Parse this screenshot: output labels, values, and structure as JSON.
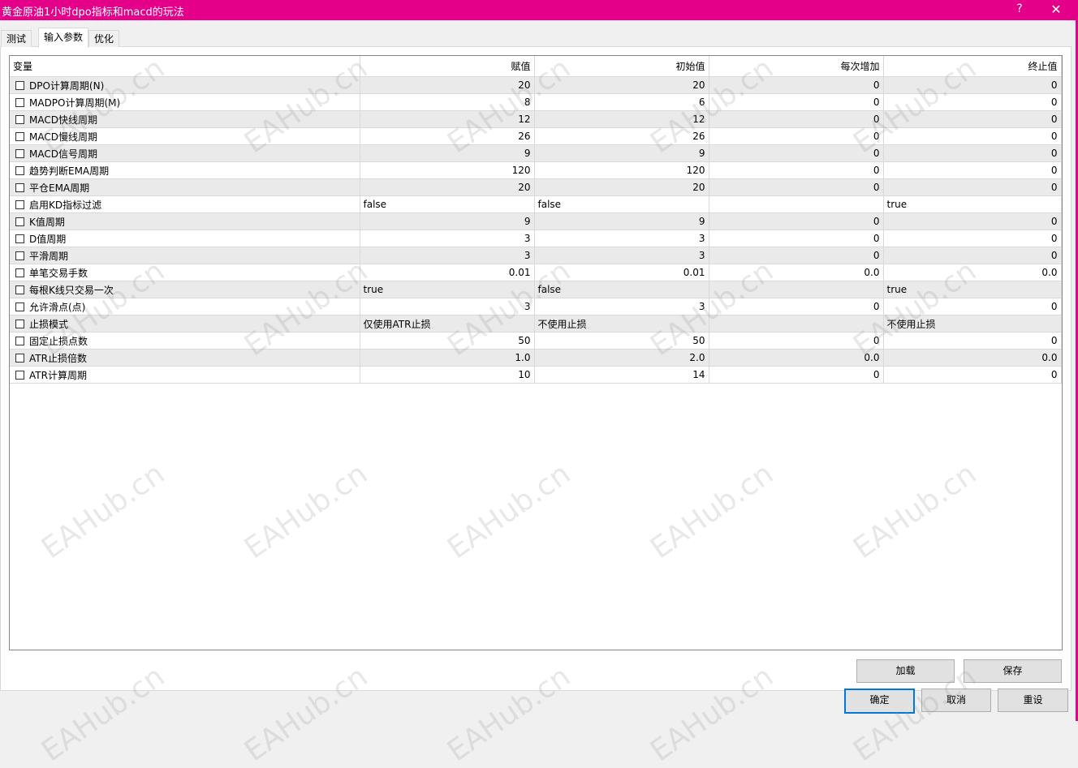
{
  "window": {
    "title": "黄金原油1小时dpo指标和macd的玩法",
    "help_label": "?",
    "close_label": "✕"
  },
  "tabs": [
    {
      "label": "测试",
      "active": false
    },
    {
      "label": "输入参数",
      "active": true
    },
    {
      "label": "优化",
      "active": false
    }
  ],
  "grid": {
    "headers": {
      "variable": "变量",
      "value": "赋值",
      "start": "初始值",
      "step": "每次增加",
      "stop": "终止值"
    },
    "rows": [
      {
        "name": "DPO计算周期(N)",
        "value": "20",
        "start": "20",
        "step": "0",
        "stop": "0"
      },
      {
        "name": "MADPO计算周期(M)",
        "value": "8",
        "start": "6",
        "step": "0",
        "stop": "0"
      },
      {
        "name": "MACD快线周期",
        "value": "12",
        "start": "12",
        "step": "0",
        "stop": "0"
      },
      {
        "name": "MACD慢线周期",
        "value": "26",
        "start": "26",
        "step": "0",
        "stop": "0"
      },
      {
        "name": "MACD信号周期",
        "value": "9",
        "start": "9",
        "step": "0",
        "stop": "0"
      },
      {
        "name": "趋势判断EMA周期",
        "value": "120",
        "start": "120",
        "step": "0",
        "stop": "0"
      },
      {
        "name": "平仓EMA周期",
        "value": "20",
        "start": "20",
        "step": "0",
        "stop": "0"
      },
      {
        "name": "启用KD指标过滤",
        "value": "false",
        "start": "false",
        "step": "",
        "stop": "true"
      },
      {
        "name": "K值周期",
        "value": "9",
        "start": "9",
        "step": "0",
        "stop": "0"
      },
      {
        "name": "D值周期",
        "value": "3",
        "start": "3",
        "step": "0",
        "stop": "0"
      },
      {
        "name": "平滑周期",
        "value": "3",
        "start": "3",
        "step": "0",
        "stop": "0"
      },
      {
        "name": "单笔交易手数",
        "value": "0.01",
        "start": "0.01",
        "step": "0.0",
        "stop": "0.0"
      },
      {
        "name": "每根K线只交易一次",
        "value": "true",
        "start": "false",
        "step": "",
        "stop": "true"
      },
      {
        "name": "允许滑点(点)",
        "value": "3",
        "start": "3",
        "step": "0",
        "stop": "0"
      },
      {
        "name": "止损模式",
        "value": "仅使用ATR止损",
        "start": "不使用止损",
        "step": "",
        "stop": "不使用止损"
      },
      {
        "name": "固定止损点数",
        "value": "50",
        "start": "50",
        "step": "0",
        "stop": "0"
      },
      {
        "name": "ATR止损倍数",
        "value": "1.0",
        "start": "2.0",
        "step": "0.0",
        "stop": "0.0"
      },
      {
        "name": "ATR计算周期",
        "value": "10",
        "start": "14",
        "step": "0",
        "stop": "0"
      }
    ]
  },
  "buttons": {
    "load": "加载",
    "save": "保存",
    "ok": "确定",
    "cancel": "取消",
    "reset": "重设"
  },
  "watermark": "EAHub.cn"
}
